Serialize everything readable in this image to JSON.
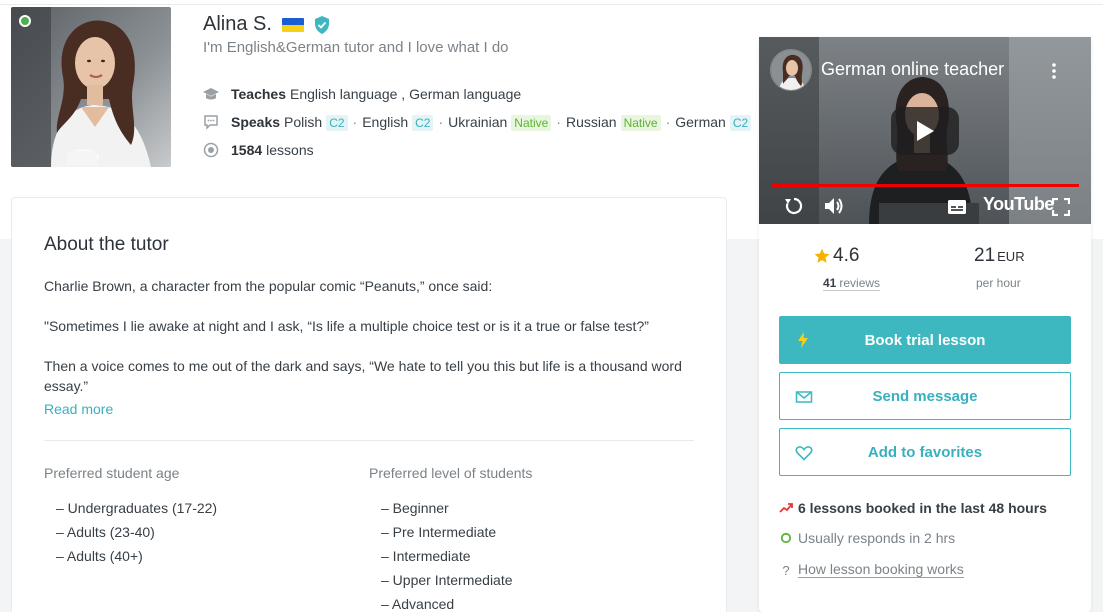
{
  "tutor": {
    "name": "Alina S.",
    "headline": "I'm English&German tutor and I love what I do",
    "flag_colors": [
      "#1a5fd0",
      "#f7d117"
    ]
  },
  "teaches": {
    "label": "Teaches",
    "value": "English language , German language"
  },
  "speaks": {
    "label": "Speaks",
    "languages": [
      {
        "name": "Polish",
        "level": "C2"
      },
      {
        "name": "English",
        "level": "C2"
      },
      {
        "name": "Ukrainian",
        "level": "Native"
      },
      {
        "name": "Russian",
        "level": "Native"
      },
      {
        "name": "German",
        "level": "C2"
      }
    ]
  },
  "lessons": {
    "count": "1584",
    "label": "lessons"
  },
  "about": {
    "title": "About the tutor",
    "paragraphs": [
      "Charlie Brown, a character from the popular comic “Peanuts,” once said:",
      "\"Sometimes I lie awake at night and I ask, “Is life a multiple choice test or is it a true or false test?”",
      "Then a voice comes to me out of the dark and says, “We hate to tell you this but life is a thousand word essay.”"
    ],
    "read_more": "Read more",
    "age": {
      "title": "Preferred student age",
      "items": [
        "– Undergraduates (17-22)",
        "– Adults (23-40)",
        "– Adults (40+)"
      ]
    },
    "level": {
      "title": "Preferred level of students",
      "items": [
        "– Beginner",
        "– Pre Intermediate",
        "– Intermediate",
        "– Upper Intermediate",
        "– Advanced"
      ]
    }
  },
  "video": {
    "title": "German online teacher",
    "brand": "YouTube"
  },
  "stats": {
    "rating": "4.6",
    "reviews_count": "41",
    "reviews_label": "reviews",
    "price": "21",
    "currency": "EUR",
    "per": "per hour"
  },
  "actions": {
    "book": "Book trial lesson",
    "message": "Send message",
    "favorite": "Add to favorites"
  },
  "meta": {
    "booked": "6 lessons booked in the last 48 hours",
    "responds": "Usually responds in 2 hrs",
    "how": "How lesson booking works"
  },
  "colors": {
    "accent": "#3db8c0",
    "native_green": "#5cb435",
    "online_green": "#4caf50",
    "star": "#f5b301",
    "trend_red": "#e53935"
  }
}
